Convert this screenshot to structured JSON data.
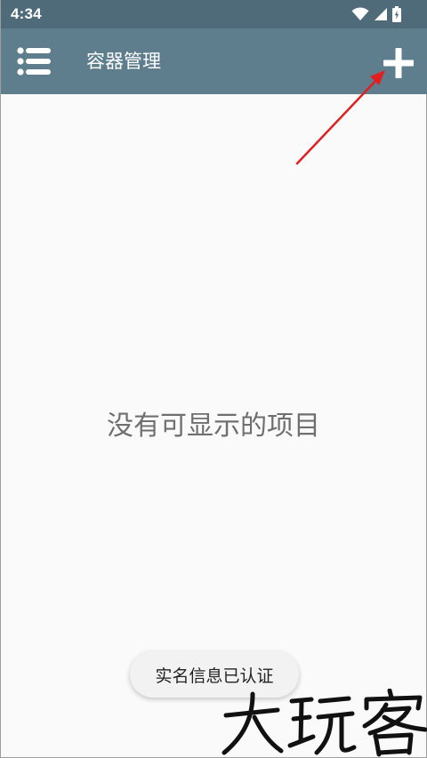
{
  "status_bar": {
    "time": "4:34",
    "icons": [
      "wifi-icon",
      "signal-icon",
      "battery-icon"
    ],
    "background": "#4f6b7a"
  },
  "app_bar": {
    "menu_icon": "list-menu-icon",
    "title": "容器管理",
    "add_icon": "plus-icon",
    "background": "#5e7d8d"
  },
  "annotation": {
    "arrow_color": "#e02020"
  },
  "main": {
    "empty_text": "没有可显示的项目"
  },
  "toast": {
    "text": "实名信息已认证"
  },
  "watermark": {
    "text": "大玩客"
  }
}
